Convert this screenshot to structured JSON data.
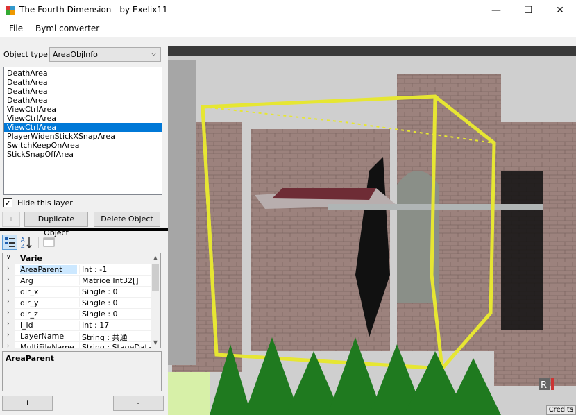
{
  "window": {
    "title": "The Fourth Dimension - by Exelix11",
    "minimize": "—",
    "maximize": "☐",
    "close": "✕"
  },
  "menu": {
    "items": [
      "File",
      "Byml converter"
    ]
  },
  "object_type": {
    "label": "Object type:",
    "selected": "AreaObjInfo"
  },
  "object_list": {
    "items": [
      "DeathArea",
      "DeathArea",
      "DeathArea",
      "DeathArea",
      "ViewCtrlArea",
      "ViewCtrlArea",
      "ViewCtrlArea",
      "PlayerWidenStickXSnapArea",
      "SwitchKeepOnArea",
      "StickSnapOffArea"
    ],
    "selected_index": 6
  },
  "hide_layer": {
    "label": "Hide this layer",
    "checked": true
  },
  "buttons": {
    "add": "+",
    "duplicate": "Duplicate Object",
    "delete": "Delete Object",
    "bottom_add": "+",
    "bottom_remove": "-"
  },
  "property_grid": {
    "category": "Varie",
    "rows": [
      {
        "name": "AreaParent",
        "value": "Int : -1"
      },
      {
        "name": "Arg",
        "value": "Matrice Int32[]"
      },
      {
        "name": "dir_x",
        "value": "Single : 0"
      },
      {
        "name": "dir_y",
        "value": "Single : 0"
      },
      {
        "name": "dir_z",
        "value": "Single : 0"
      },
      {
        "name": "l_id",
        "value": "Int : 17"
      },
      {
        "name": "LayerName",
        "value": "String : 共通"
      },
      {
        "name": "MultiFileName",
        "value": "String : StageData_to"
      }
    ],
    "description_title": "AreaParent"
  },
  "viewport": {
    "credits": "Credits",
    "colors": {
      "sky": "#c9c9c9",
      "wall": "#a08580",
      "area_box": "#e6e633",
      "tree": "#1f7a1f"
    }
  }
}
